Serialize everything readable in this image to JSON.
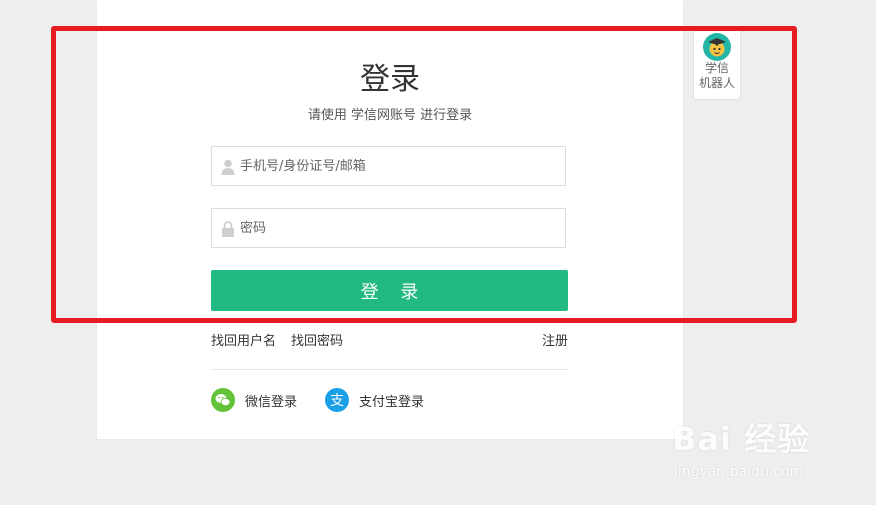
{
  "login": {
    "title": "登录",
    "subtitle": "请使用 学信网账号 进行登录",
    "username_placeholder": "手机号/身份证号/邮箱",
    "password_placeholder": "密码",
    "submit_label": "登 录",
    "forgot_username": "找回用户名",
    "forgot_password": "找回密码",
    "register": "注册"
  },
  "social": {
    "wechat_label": "微信登录",
    "alipay_label": "支付宝登录",
    "wechat_color": "#62c33b",
    "alipay_color": "#1aa0e8"
  },
  "robot": {
    "label_line1": "学信",
    "label_line2": "机器人"
  },
  "colors": {
    "accent": "#22b983",
    "highlight_border": "#e51d23"
  },
  "watermark": {
    "brand": "Bai 经验",
    "url": "jingyan.baidu.com"
  }
}
